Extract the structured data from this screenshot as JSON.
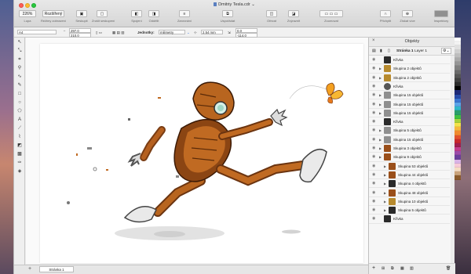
{
  "window": {
    "title": "Dmitriy Tesla.cdr"
  },
  "toolbar": {
    "zoom_value": "226%",
    "zoom_label": "Lupa",
    "view_mode_value": "Rozšířený",
    "view_mode_label": "Režimy zobrazení",
    "items": [
      {
        "label": "Seskupit"
      },
      {
        "label": "Zrušit seskupení"
      },
      {
        "label": "Spojení"
      },
      {
        "label": "Oddělit"
      },
      {
        "label": "Zarovnání"
      },
      {
        "label": "Uspořádat"
      },
      {
        "label": "Ořezat"
      },
      {
        "label": "Zvýraznit"
      },
      {
        "label": "Uspořádání"
      },
      {
        "label": "Zarovnat"
      },
      {
        "label": "Zoomovat"
      },
      {
        "label": "Přichytit"
      },
      {
        "label": "Získat více"
      },
      {
        "label": "Inspektory"
      }
    ]
  },
  "properties": {
    "paper_size": "A4",
    "x_value": "297.0",
    "y_value": "210.0",
    "units_label": "Jednotky:",
    "units_value": "milimetry",
    "nudge_value": "2.54 mm",
    "dup_x": "0.0",
    "dup_y": "-114.0"
  },
  "status": {
    "page_tab": "Stránka 1"
  },
  "objects_panel": {
    "title": "Objekty",
    "page_label": "Stránka 1",
    "layer_label": "Layer 1",
    "items": [
      {
        "label": "Křivka",
        "expandable": false,
        "indent": 0,
        "thumb": "swatch-dark"
      },
      {
        "label": "Skupina 2 objektů",
        "expandable": true,
        "indent": 0,
        "thumb": "swatch-gold"
      },
      {
        "label": "Skupina 2 objektů",
        "expandable": true,
        "indent": 0,
        "thumb": "swatch-gold"
      },
      {
        "label": "Křivka",
        "expandable": false,
        "indent": 0,
        "thumb": "swatch-ring"
      },
      {
        "label": "Skupina 15 objektů",
        "expandable": true,
        "indent": 0,
        "thumb": "swatch-gray"
      },
      {
        "label": "Skupina 15 objektů",
        "expandable": true,
        "indent": 0,
        "thumb": "swatch-gray"
      },
      {
        "label": "Skupina 15 objektů",
        "expandable": true,
        "indent": 0,
        "thumb": "swatch-gray"
      },
      {
        "label": "Křivka",
        "expandable": false,
        "indent": 0,
        "thumb": "swatch-dark"
      },
      {
        "label": "Skupina 5 objektů",
        "expandable": true,
        "indent": 0,
        "thumb": "swatch-gray"
      },
      {
        "label": "Skupina 15 objektů",
        "expandable": true,
        "indent": 0,
        "thumb": "swatch-gray"
      },
      {
        "label": "Skupina 3 objektů",
        "expandable": true,
        "indent": 0,
        "thumb": "swatch-brown"
      },
      {
        "label": "Skupina 9 objektů",
        "expandable": true,
        "indent": 0,
        "thumb": "swatch-brown"
      },
      {
        "label": "Skupina 53 objektů",
        "expandable": true,
        "indent": 1,
        "thumb": "swatch-brown"
      },
      {
        "label": "Skupina 44 objektů",
        "expandable": true,
        "indent": 1,
        "thumb": "swatch-brown"
      },
      {
        "label": "Skupina 4 objektů",
        "expandable": true,
        "indent": 1,
        "thumb": "swatch-dark"
      },
      {
        "label": "Skupina 48 objektů",
        "expandable": true,
        "indent": 1,
        "thumb": "swatch-brown"
      },
      {
        "label": "Skupina 10 objektů",
        "expandable": true,
        "indent": 1,
        "thumb": "swatch-gold"
      },
      {
        "label": "Skupina 5 objektů",
        "expandable": true,
        "indent": 1,
        "thumb": "swatch-dark"
      },
      {
        "label": "Křivka",
        "expandable": false,
        "indent": 0,
        "thumb": "swatch-dark"
      }
    ]
  },
  "palette": [
    "#ffffff",
    "#f2f2f2",
    "#e0e0e0",
    "#cfcfcf",
    "#bdbdbd",
    "#a9a9a9",
    "#959595",
    "#7f7f7f",
    "#6a6a6a",
    "#555555",
    "#404040",
    "#2a2a2a",
    "#000000",
    "#1e2a78",
    "#274aa8",
    "#3a74d0",
    "#5aa4e8",
    "#2fb5c8",
    "#2a9d6a",
    "#3fbf3f",
    "#a6d13a",
    "#f4e24a",
    "#f6b73c",
    "#f08a2e",
    "#e2502c",
    "#c9282d",
    "#a01e4e",
    "#c23d8c",
    "#9b4aa8",
    "#6a3d9a",
    "#d9b3e6",
    "#f7c9d6",
    "#f5dcc2",
    "#c9a27a",
    "#8a5a2b"
  ],
  "colors": {
    "accent": "#3c7be0",
    "panel_bg": "#f6f6f6"
  }
}
